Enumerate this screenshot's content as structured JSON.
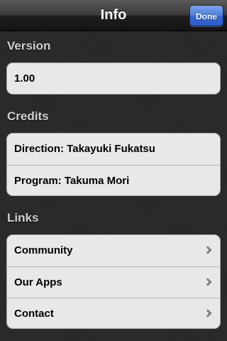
{
  "navbar": {
    "title": "Info",
    "done_label": "Done"
  },
  "sections": {
    "version": {
      "header": "Version",
      "rows": [
        "1.00"
      ]
    },
    "credits": {
      "header": "Credits",
      "rows": [
        "Direction: Takayuki Fukatsu",
        "Program: Takuma Mori"
      ]
    },
    "links": {
      "header": "Links",
      "rows": [
        "Community",
        "Our Apps",
        "Contact"
      ]
    }
  },
  "colors": {
    "background": "#2a2a2a",
    "done_button": "#3466d2",
    "cell": "#e8e8e8"
  }
}
